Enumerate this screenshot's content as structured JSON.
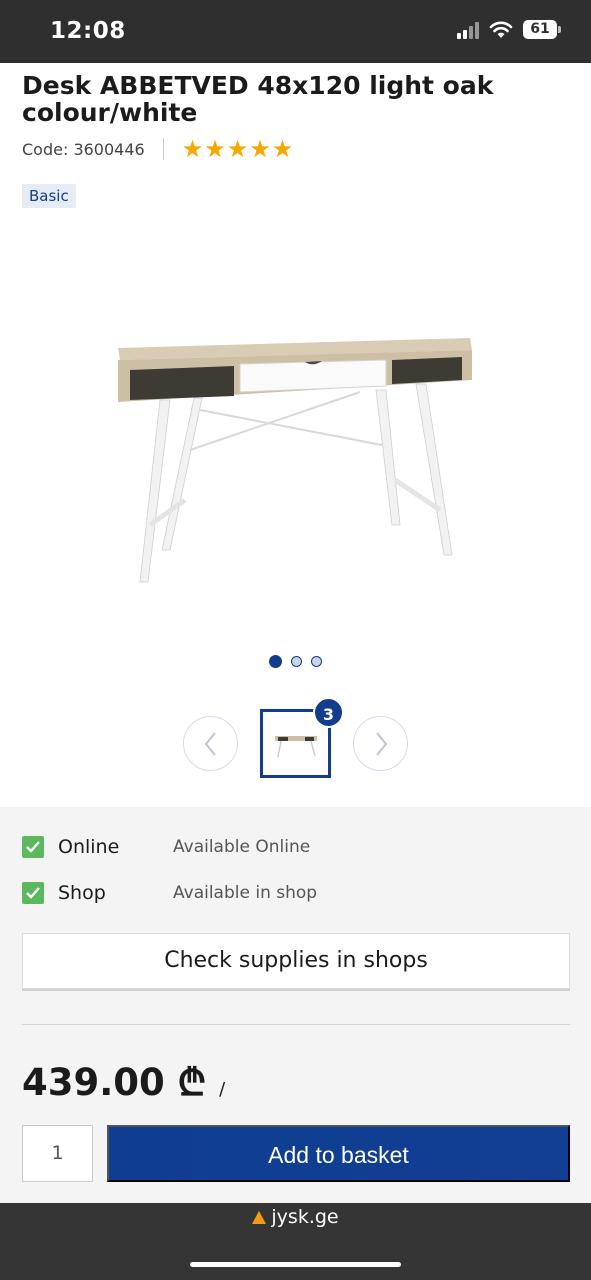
{
  "status_bar": {
    "time": "12:08",
    "battery": "61"
  },
  "product": {
    "title": "Desk ABBETVED 48x120 light oak colour/white",
    "code": "Code: 3600446",
    "rating_stars": 5,
    "badge": "Basic",
    "image_icon": "desk-product-image"
  },
  "gallery": {
    "dots": [
      "active",
      "inactive",
      "inactive"
    ],
    "thumbnail_count": "3",
    "prev_icon": "chevron-left-icon",
    "next_icon": "chevron-right-icon"
  },
  "availability": {
    "rows": [
      {
        "label": "Online",
        "value": "Available Online"
      },
      {
        "label": "Shop",
        "value": "Available in shop"
      }
    ],
    "check_button": "Check supplies in shops"
  },
  "purchase": {
    "price": "439.00 ₾",
    "price_unit": "/",
    "quantity": "1",
    "add_button": "Add to basket"
  },
  "browser": {
    "url": "jysk.ge"
  },
  "colors": {
    "brand_blue": "#143c8c",
    "star": "#f5a800",
    "check_green": "#5cb85c"
  }
}
